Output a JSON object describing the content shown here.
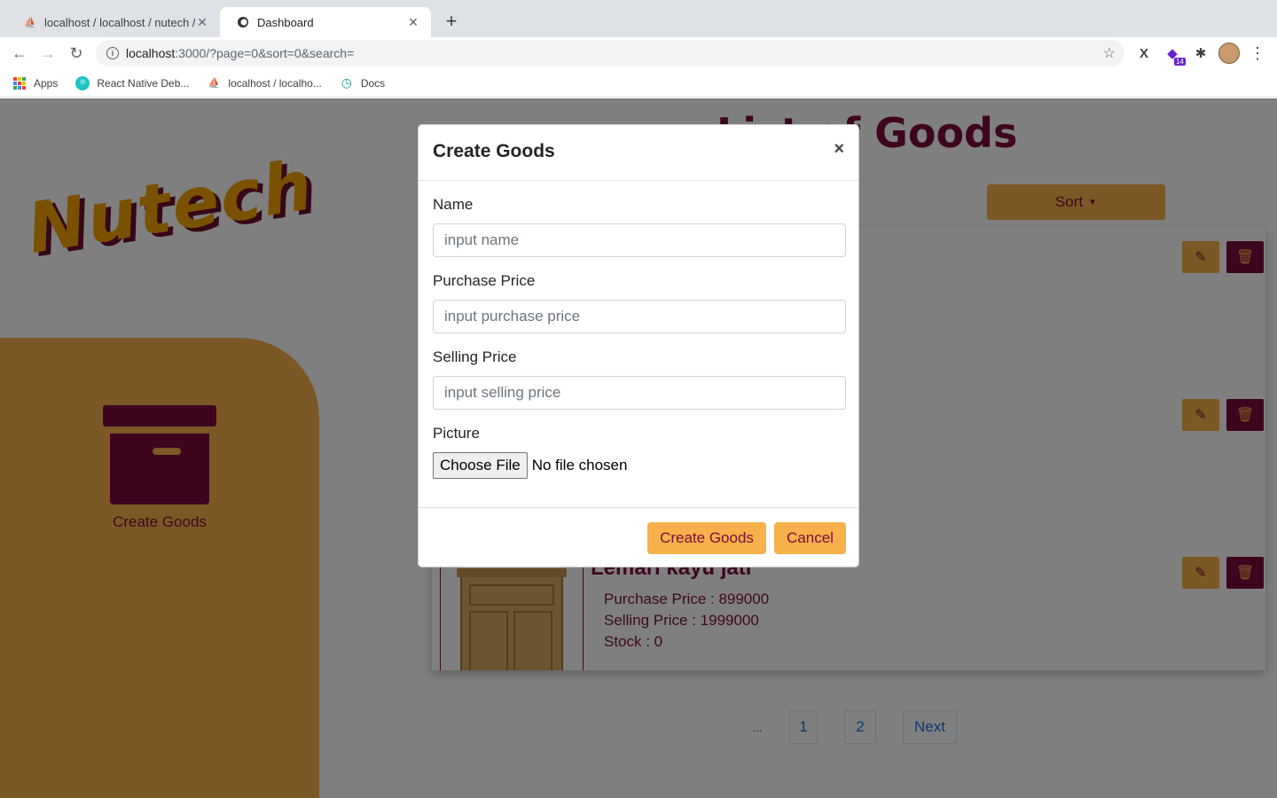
{
  "browser": {
    "tabs": [
      {
        "title": "localhost / localhost / nutech /",
        "active": false
      },
      {
        "title": "Dashboard",
        "active": true
      }
    ],
    "url_host": "localhost",
    "url_rest": ":3000/?page=0&sort=0&search=",
    "ext_badge": "14",
    "bookmarks": [
      {
        "label": "Apps",
        "icon": "apps-grid-icon"
      },
      {
        "label": "React Native Deb...",
        "icon": "react-icon"
      },
      {
        "label": "localhost / localho...",
        "icon": "phpmyadmin-icon"
      },
      {
        "label": "Docs",
        "icon": "clock-icon"
      }
    ]
  },
  "sidebar": {
    "logo": "Nutech",
    "create_label": "Create Goods",
    "icon": "archive-box-icon"
  },
  "main": {
    "title": "List of Goods",
    "sort_label": "Sort",
    "item": {
      "name": "Lemari kayu jati",
      "purchase_price": "Purchase Price : 899000",
      "selling_price": "Selling Price : 1999000",
      "stock": "Stock : 0"
    },
    "pagination": {
      "ellipsis": "...",
      "pages": [
        "1",
        "2"
      ],
      "next": "Next"
    }
  },
  "modal": {
    "title": "Create Goods",
    "close": "×",
    "fields": [
      {
        "label": "Name",
        "placeholder": "input name"
      },
      {
        "label": "Purchase Price",
        "placeholder": "input purchase price"
      },
      {
        "label": "Selling Price",
        "placeholder": "input selling price"
      }
    ],
    "picture_label": "Picture",
    "file_button": "Choose File",
    "file_status": "No file chosen",
    "submit": "Create Goods",
    "cancel": "Cancel"
  },
  "colors": {
    "brand_maroon": "#7a0d3c",
    "brand_orange": "#f7b14a",
    "logo_yellow": "#f4a300"
  }
}
